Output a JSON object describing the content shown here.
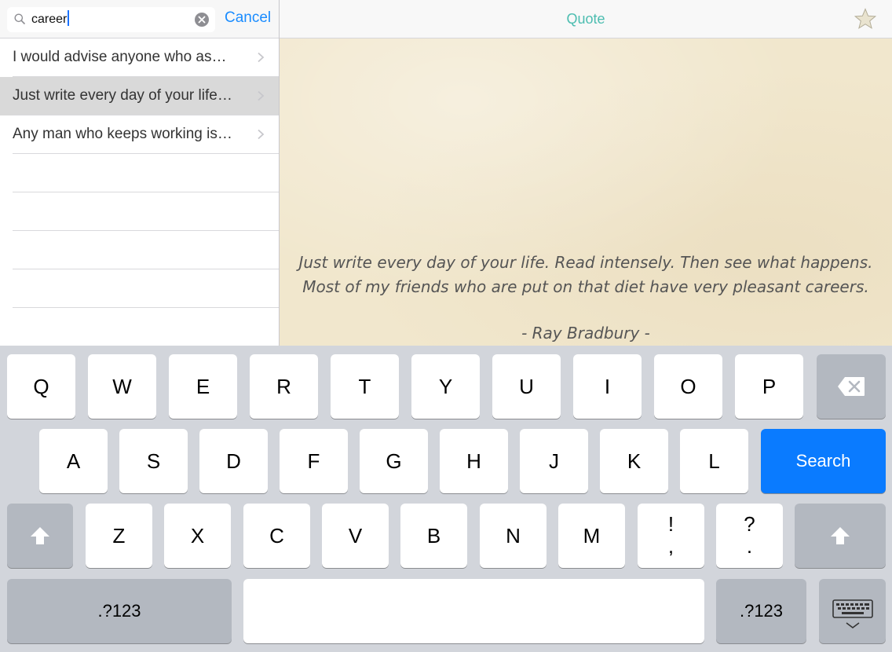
{
  "search": {
    "query": "career",
    "cancel_label": "Cancel"
  },
  "results": [
    {
      "text": "I would advise anyone who as…",
      "selected": false
    },
    {
      "text": "Just write every day of your life…",
      "selected": true
    },
    {
      "text": "Any man who keeps working is…",
      "selected": false
    }
  ],
  "detail": {
    "title": "Quote",
    "quote_line1": "Just write every day of your life. Read intensely. Then see what happens.",
    "quote_line2": "Most of my friends who are put on that diet have very pleasant careers.",
    "author": "-  Ray Bradbury  -"
  },
  "keyboard": {
    "row1": [
      "Q",
      "W",
      "E",
      "R",
      "T",
      "Y",
      "U",
      "I",
      "O",
      "P"
    ],
    "row2": [
      "A",
      "S",
      "D",
      "F",
      "G",
      "H",
      "J",
      "K",
      "L"
    ],
    "row3": [
      "Z",
      "X",
      "C",
      "V",
      "B",
      "N",
      "M"
    ],
    "punct1": [
      "!",
      ","
    ],
    "punct2": [
      "?",
      "."
    ],
    "search_label": "Search",
    "numbers_label": ".?123"
  },
  "colors": {
    "accent_blue": "#0a7bff",
    "title_teal": "#4cbdb0",
    "paper": "#f1e7cd"
  }
}
